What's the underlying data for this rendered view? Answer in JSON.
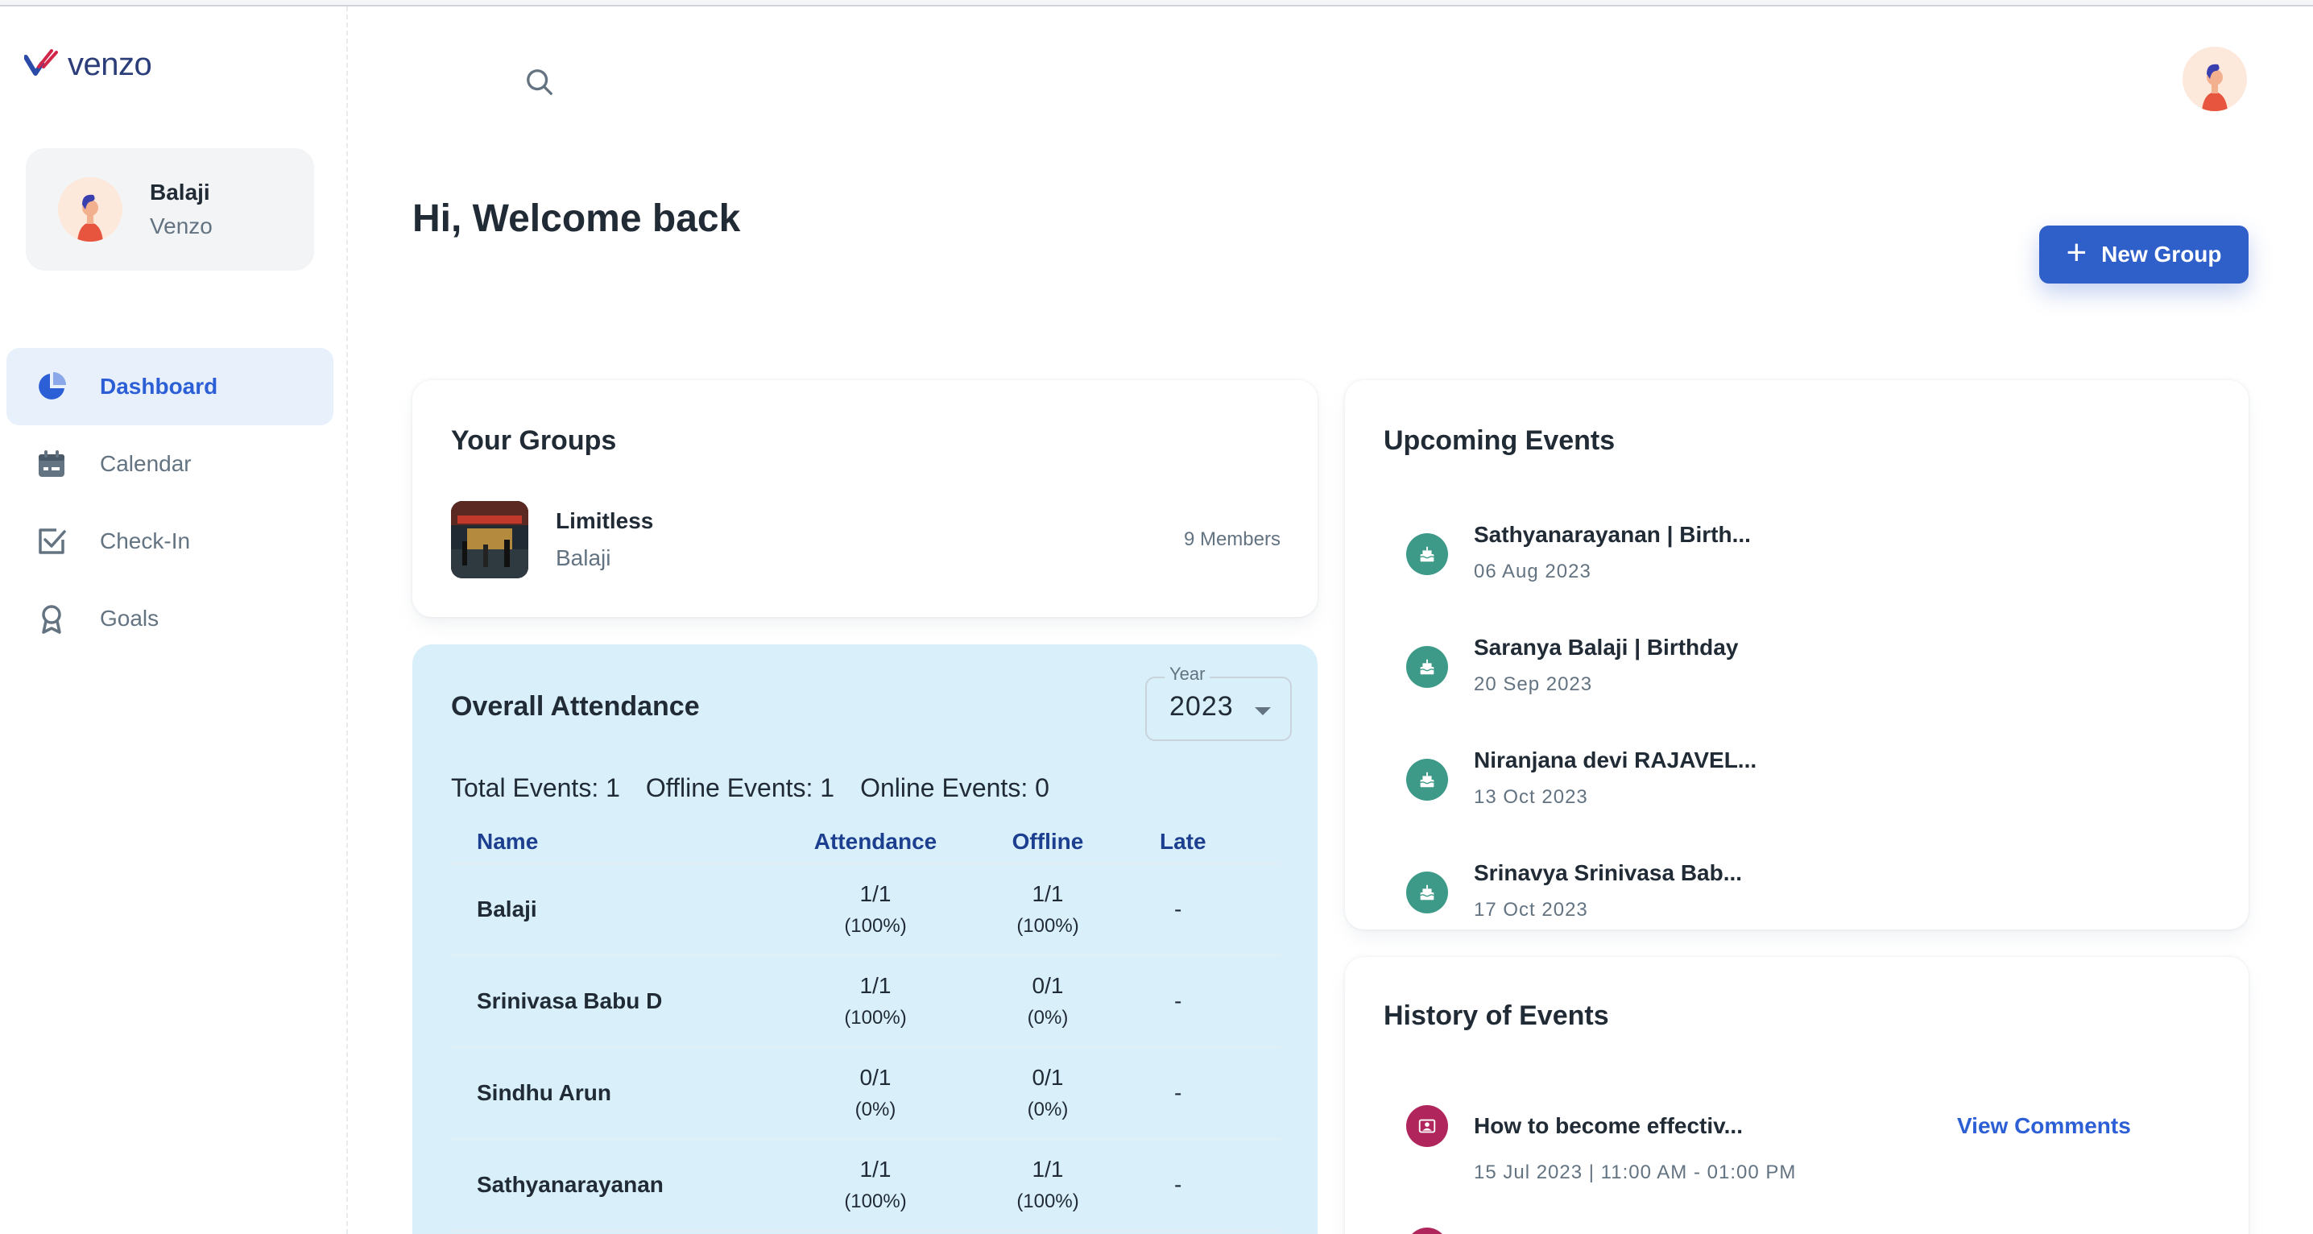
{
  "brand": {
    "name": "venzo"
  },
  "account": {
    "name": "Balaji",
    "org": "Venzo"
  },
  "nav": [
    {
      "label": "Dashboard",
      "icon": "pie-chart-icon",
      "active": true
    },
    {
      "label": "Calendar",
      "icon": "calendar-icon",
      "active": false
    },
    {
      "label": "Check-In",
      "icon": "checkbox-icon",
      "active": false
    },
    {
      "label": "Goals",
      "icon": "award-icon",
      "active": false
    }
  ],
  "header": {
    "greeting": "Hi, Welcome back",
    "new_group_label": "New Group"
  },
  "groups": {
    "title": "Your Groups",
    "items": [
      {
        "name": "Limitless",
        "owner": "Balaji",
        "members": "9 Members"
      }
    ]
  },
  "attendance": {
    "title": "Overall Attendance",
    "year_label": "Year",
    "year_value": "2023",
    "stats": {
      "total": "Total Events: 1",
      "offline": "Offline Events: 1",
      "online": "Online Events: 0"
    },
    "columns": [
      "Name",
      "Attendance",
      "Offline",
      "Late"
    ],
    "rows": [
      {
        "name": "Balaji",
        "attendance": "1/1",
        "attendance_pct": "(100%)",
        "offline": "1/1",
        "offline_pct": "(100%)",
        "late": "-"
      },
      {
        "name": "Srinivasa Babu D",
        "attendance": "1/1",
        "attendance_pct": "(100%)",
        "offline": "0/1",
        "offline_pct": "(0%)",
        "late": "-"
      },
      {
        "name": "Sindhu Arun",
        "attendance": "0/1",
        "attendance_pct": "(0%)",
        "offline": "0/1",
        "offline_pct": "(0%)",
        "late": "-"
      },
      {
        "name": "Sathyanarayanan",
        "attendance": "1/1",
        "attendance_pct": "(100%)",
        "offline": "1/1",
        "offline_pct": "(100%)",
        "late": "-"
      }
    ]
  },
  "upcoming": {
    "title": "Upcoming Events",
    "items": [
      {
        "title": "Sathyanarayanan | Birth...",
        "date": "06 Aug 2023"
      },
      {
        "title": "Saranya Balaji | Birthday",
        "date": "20 Sep 2023"
      },
      {
        "title": "Niranjana devi RAJAVEL...",
        "date": "13 Oct 2023"
      },
      {
        "title": "Srinavya Srinivasa Bab...",
        "date": "17 Oct 2023"
      }
    ]
  },
  "history": {
    "title": "History of Events",
    "items": [
      {
        "title": "How to become effectiv...",
        "date": "15 Jul 2023 | 11:00 AM - 01:00 PM",
        "action": "View Comments"
      }
    ]
  },
  "colors": {
    "primary": "#2f5fc9",
    "event_green": "#3d9a89",
    "history_red": "#b0265c",
    "attendance_bg": "#d9f0fb"
  }
}
